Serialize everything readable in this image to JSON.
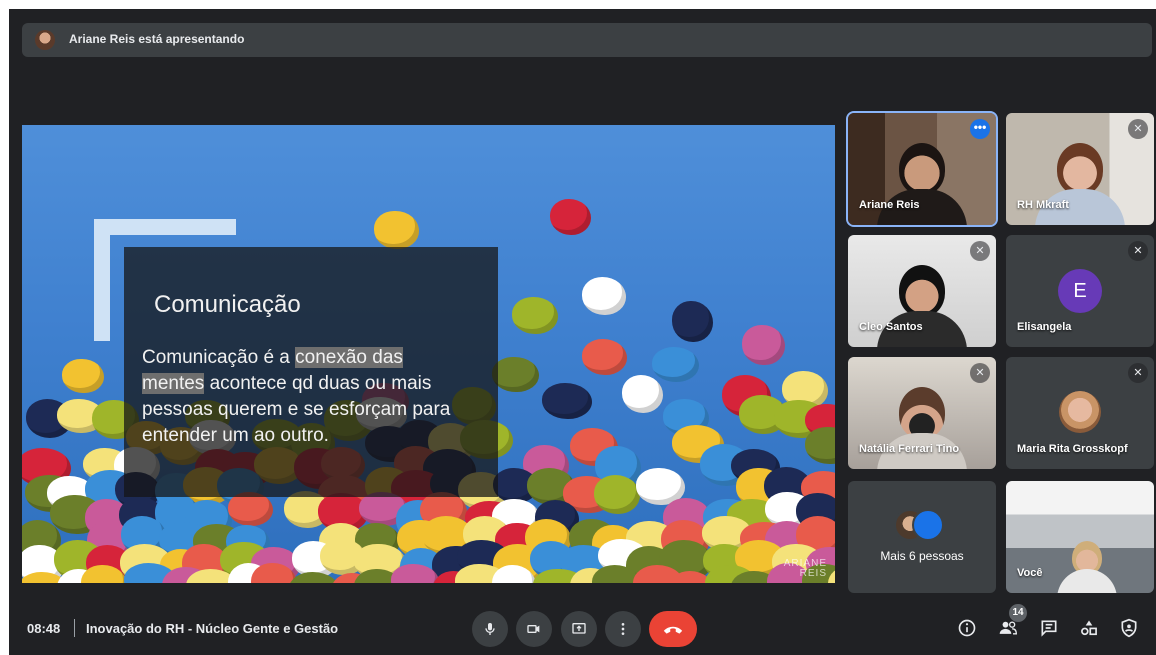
{
  "presenting": {
    "text": "Ariane Reis está apresentando"
  },
  "slide": {
    "title": "Comunicação",
    "body_before": "Comunicação é a ",
    "body_highlight1": "conexão das",
    "body_highlight2": "mentes",
    "body_after": " acontece qd duas ou mais pessoas querem e se esforçam para entender um ao outro.",
    "watermark": "ARIANE REIS"
  },
  "participants": [
    {
      "name": "Ariane Reis",
      "active": true
    },
    {
      "name": "RH Mkraft",
      "muted": true
    },
    {
      "name": "Cleo Santos",
      "muted": true
    },
    {
      "name": "Elisangela",
      "muted": true,
      "initial": "E"
    },
    {
      "name": "Natália Ferrari Tino",
      "muted": true
    },
    {
      "name": "Maria Rita Grosskopf",
      "muted": true
    },
    {
      "name": "Mais 6 pessoas"
    },
    {
      "name": "Você"
    }
  ],
  "bottom_bar": {
    "time": "08:48",
    "meeting_title": "Inovação do RH - Núcleo Gente e Gestão",
    "people_count": "14"
  },
  "colors": {
    "background": "#202124",
    "tile": "#3c4043",
    "end_call": "#ea4335",
    "accent": "#1a73e8",
    "letter_avatar": "#673ab7"
  },
  "icons": [
    "mic-icon",
    "camera-icon",
    "present-icon",
    "more-options-icon",
    "end-call-icon",
    "info-icon",
    "people-icon",
    "chat-icon",
    "activities-icon",
    "host-controls-icon",
    "mic-off-icon"
  ]
}
